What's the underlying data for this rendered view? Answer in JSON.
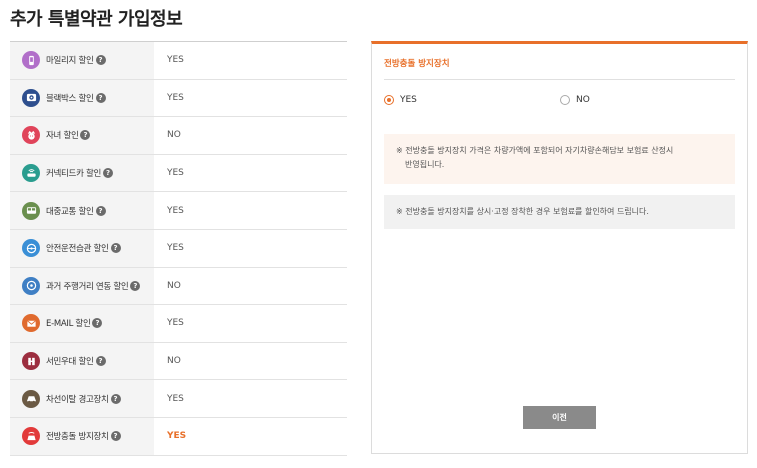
{
  "page": {
    "title": "추가 특별약관 가입정보"
  },
  "options": [
    {
      "label": "마일리지 할인",
      "value": "YES",
      "icon": "mileage-phone-icon",
      "color": "#b16fc9",
      "active": false
    },
    {
      "label": "블랙박스 할인",
      "value": "YES",
      "icon": "black-box-camera-icon",
      "color": "#2e4f8e",
      "active": false
    },
    {
      "label": "자녀 할인",
      "value": "NO",
      "icon": "child-face-icon",
      "color": "#e0445a",
      "active": false
    },
    {
      "label": "커넥티드카 할인",
      "value": "YES",
      "icon": "connected-car-icon",
      "color": "#2a9d8f",
      "active": false
    },
    {
      "label": "대중교통 할인",
      "value": "YES",
      "icon": "bus-icon",
      "color": "#6a8f4e",
      "active": false
    },
    {
      "label": "안전운전습관 할인",
      "value": "YES",
      "icon": "steering-wheel-icon",
      "color": "#3a8fd6",
      "active": false
    },
    {
      "label": "과거 주행거리 연동 할인",
      "value": "NO",
      "icon": "odometer-icon",
      "color": "#3f7fc4",
      "active": false
    },
    {
      "label": "E-MAIL 할인",
      "value": "YES",
      "icon": "email-icon",
      "color": "#e06a2e",
      "active": false
    },
    {
      "label": "서민우대 할인",
      "value": "NO",
      "icon": "citizen-icon",
      "color": "#9c2e3f",
      "active": false
    },
    {
      "label": "차선이탈 경고장치",
      "value": "YES",
      "icon": "lane-departure-car-icon",
      "color": "#6b5a44",
      "active": false
    },
    {
      "label": "전방충돌 방지장치",
      "value": "YES",
      "icon": "forward-collision-car-icon",
      "color": "#e23a3a",
      "active": true
    }
  ],
  "help_glyph": "?",
  "panel": {
    "title": "전방충돌 방지장치",
    "radio_yes": "YES",
    "radio_no": "NO",
    "selected": "YES",
    "notice1_line1": "※ 전방충돌 방지장치 가격은 차량가액에 포함되어 자기차량손해담보 보험료 산정시",
    "notice1_line2": "반영됩니다.",
    "notice2": "※ 전방충돌 방지장치를 상시·고정 장착한 경우 보험료를 할인하여 드립니다.",
    "button": "이전"
  },
  "colors": {
    "accent": "#e8702a",
    "button": "#8a8a8a"
  }
}
